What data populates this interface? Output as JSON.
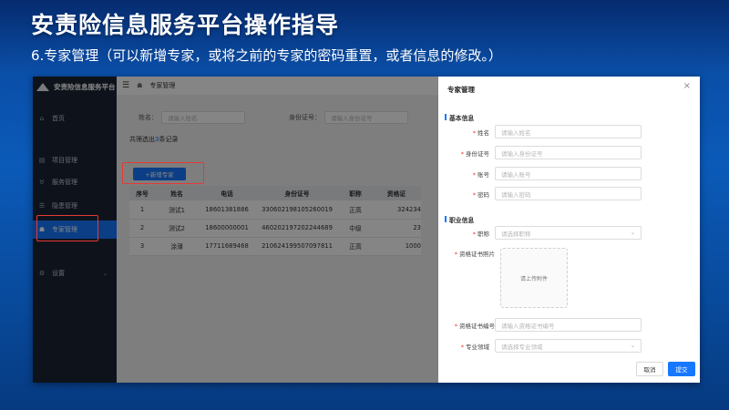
{
  "slide": {
    "title": "安责险信息服务平台操作指导",
    "subtitle": "6.专家管理（可以新增专家，或将之前的专家的密码重置，或者信息的修改。）"
  },
  "app": {
    "brand": "安责险信息服务平台",
    "breadcrumb": "专家管理",
    "menu_icon": "hamburger-icon",
    "sidebar": [
      {
        "label": "首页",
        "icon": "home-icon"
      },
      {
        "label": "项目管理",
        "icon": "document-icon"
      },
      {
        "label": "服务管理",
        "icon": "shield-icon"
      },
      {
        "label": "隐患管理",
        "icon": "list-icon"
      },
      {
        "label": "专家管理",
        "icon": "person-icon",
        "active": true
      },
      {
        "label": "设置",
        "icon": "gear-icon"
      }
    ],
    "search": {
      "name_label": "姓名：",
      "name_placeholder": "请输入姓名",
      "id_label": "身份证号：",
      "id_placeholder": "请输入身份证号"
    },
    "count_prefix": "共筛选出",
    "count_value": "3",
    "count_suffix": "条记录",
    "add_button": "+新增专家",
    "table": {
      "headers": [
        "序号",
        "姓名",
        "电话",
        "身份证号",
        "职称",
        "资格证"
      ],
      "rows": [
        [
          "1",
          "测试1",
          "18601381886",
          "330602198105260019",
          "正高",
          "324234"
        ],
        [
          "2",
          "测试2",
          "18600000001",
          "460202197202244689",
          "中级",
          "23"
        ],
        [
          "3",
          "涂薄",
          "17711689468",
          "210624199507097811",
          "正高",
          "1000"
        ]
      ]
    }
  },
  "drawer": {
    "title": "专家管理",
    "close_icon": "close-icon",
    "basic_section": "基本信息",
    "fields": {
      "name": {
        "label": "姓名",
        "placeholder": "请输入姓名"
      },
      "id_no": {
        "label": "身份证号",
        "placeholder": "请输入身份证号"
      },
      "account": {
        "label": "账号",
        "placeholder": "请输入账号"
      },
      "password": {
        "label": "密码",
        "placeholder": "请输入密码"
      }
    },
    "career_section": "职业信息",
    "title_field": {
      "label": "职称",
      "placeholder": "请选择职称"
    },
    "photo_field": {
      "label": "资格证书照片",
      "upload_text": "请上传附件"
    },
    "cert_no": {
      "label": "资格证书编号",
      "placeholder": "请输入资格证书编号"
    },
    "specialty": {
      "label": "专业领域",
      "placeholder": "请选择专业领域"
    },
    "cancel_button": "取消",
    "submit_button": "提交"
  },
  "colors": {
    "primary": "#1677ff",
    "sidebar_bg": "#1b2535",
    "highlight": "#e53935"
  }
}
